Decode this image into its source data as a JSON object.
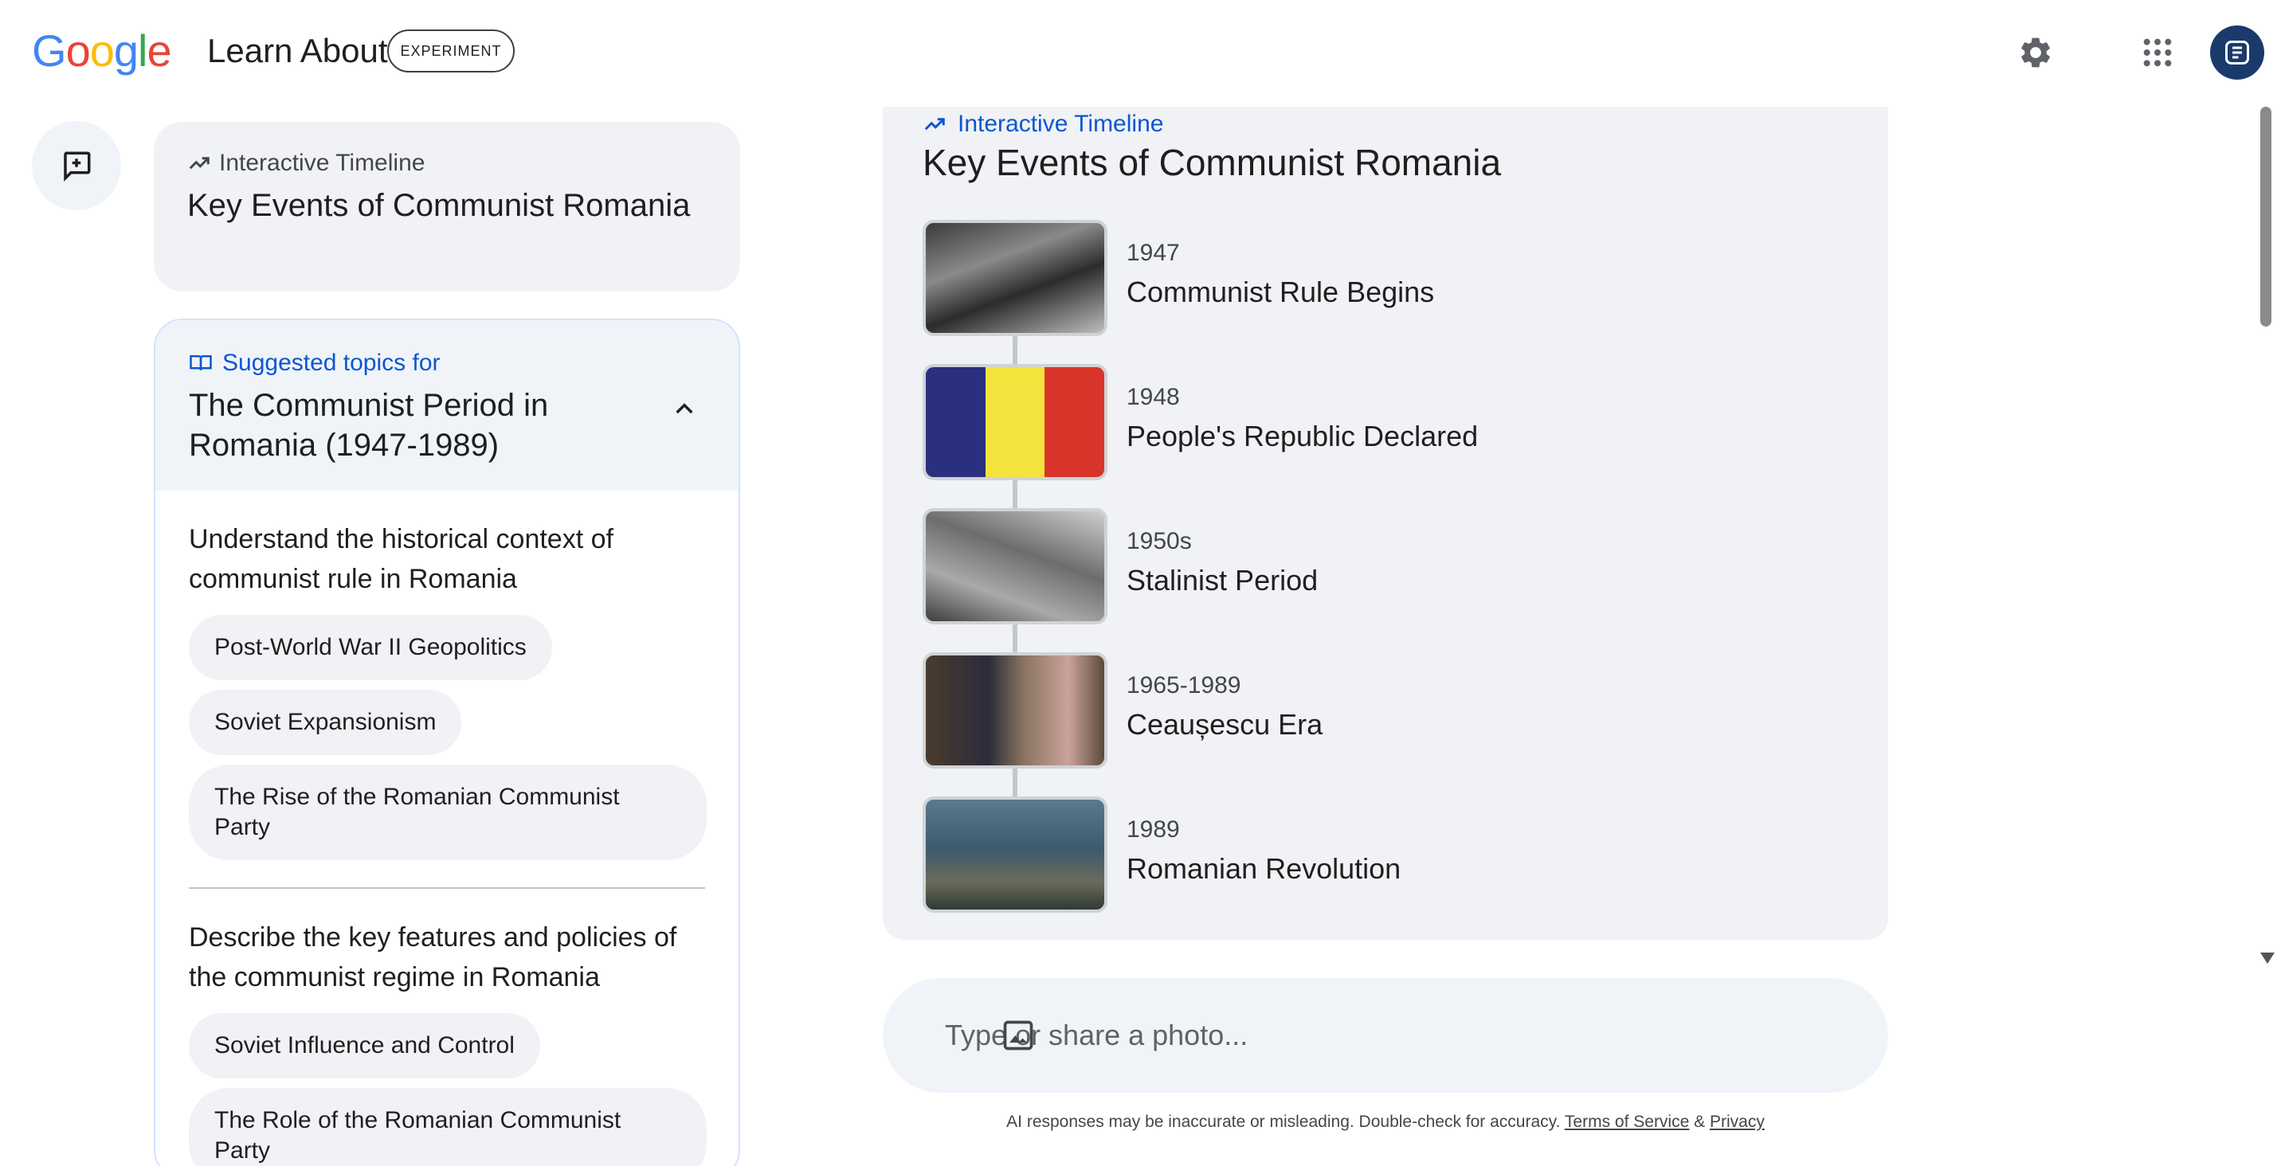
{
  "header": {
    "logo_letters": [
      "G",
      "o",
      "o",
      "g",
      "l",
      "e"
    ],
    "logo_colors": [
      "#4285F4",
      "#EA4335",
      "#FBBC05",
      "#4285F4",
      "#34A853",
      "#EA4335"
    ],
    "app_title": "Learn About",
    "badge": "EXPERIMENT",
    "icons": [
      "gear-icon",
      "apps-grid-icon",
      "avatar"
    ]
  },
  "history": {
    "kicker": "Interactive Timeline",
    "title": "Key Events of Communist Romania"
  },
  "topics": {
    "kicker": "Suggested topics for",
    "title": "The Communist Period in Romania (1947-1989)",
    "sections": [
      {
        "question": "Understand the historical context of communist rule in Romania",
        "chips": [
          "Post-World War II Geopolitics",
          "Soviet Expansionism",
          "The Rise of the Romanian Communist Party"
        ]
      },
      {
        "question": "Describe the key features and policies of the communist regime in Romania",
        "chips": [
          "Soviet Influence and Control",
          "The Role of the Romanian Communist Party"
        ]
      }
    ]
  },
  "timeline": {
    "kicker": "Interactive Timeline",
    "title": "Key Events of Communist Romania",
    "events": [
      {
        "year": "1947",
        "title": "Communist Rule Begins"
      },
      {
        "year": "1948",
        "title": "People's Republic Declared"
      },
      {
        "year": "1950s",
        "title": "Stalinist Period"
      },
      {
        "year": "1965-1989",
        "title": "Ceaușescu Era"
      },
      {
        "year": "1989",
        "title": "Romanian Revolution"
      }
    ],
    "flag_colors": [
      "#2a2f7f",
      "#f2e43c",
      "#d9342a"
    ]
  },
  "prompt": {
    "placeholder": "Type or share a photo..."
  },
  "footer": {
    "disclaimer": "AI responses may be inaccurate or misleading. Double-check for accuracy.",
    "terms": "Terms of Service",
    "amp": "&",
    "privacy": "Privacy"
  },
  "colors": {
    "accent_blue": "#0b57d0",
    "card_gray": "#f0f2f5",
    "avatar_bg": "#1a3a6b"
  }
}
